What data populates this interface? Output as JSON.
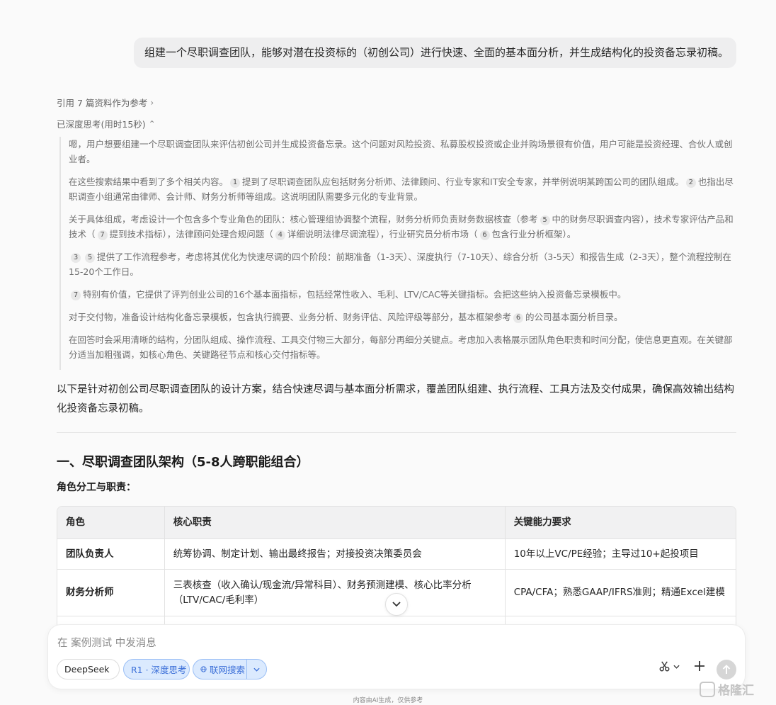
{
  "user_message": "组建一个尽职调查团队，能够对潜在投资标的（初创公司）进行快速、全面的基本面分析，并生成结构化的投资备忘录初稿。",
  "references": {
    "label": "引用 7 篇资料作为参考",
    "chevron": "›"
  },
  "thinking": {
    "label": "已深度思考(用时15秒)",
    "chevron": "⌃",
    "p1": "嗯，用户想要组建一个尽职调查团队来评估初创公司并生成投资备忘录。这个问题对风险投资、私募股权投资或企业并购场景很有价值，用户可能是投资经理、合伙人或创业者。",
    "p2a": "在这些搜索结果中看到了多个相关内容。",
    "p2r1": "1",
    "p2b": "提到了尽职调查团队应包括财务分析师、法律顾问、行业专家和IT安全专家，并举例说明某跨国公司的团队组成。",
    "p2r2": "2",
    "p2c": "也指出尽职调查小组通常由律师、会计师、财务分析师等组成。这说明团队需要多元化的专业背景。",
    "p3a": "关于具体组成，考虑设计一个包含多个专业角色的团队：核心管理组协调整个流程，财务分析师负责财务数据核查（参考",
    "p3r1": "5",
    "p3b": "中的财务尽职调查内容），技术专家评估产品和技术（",
    "p3r2": "7",
    "p3c": "提到技术指标），法律顾问处理合规问题（",
    "p3r3": "4",
    "p3d": "详细说明法律尽调流程），行业研究员分析市场（",
    "p3r4": "6",
    "p3e": "包含行业分析框架）。",
    "p4r1": "3",
    "p4r2": "5",
    "p4a": "提供了工作流程参考，考虑将其优化为快速尽调的四个阶段：前期准备（1-3天）、深度执行（7-10天）、综合分析（3-5天）和报告生成（2-3天），整个流程控制在15-20个工作日。",
    "p5r1": "7",
    "p5a": "特别有价值，它提供了评判创业公司的16个基本面指标，包括经常性收入、毛利、LTV/CAC等关键指标。会把这些纳入投资备忘录模板中。",
    "p6a": "对于交付物，准备设计结构化备忘录模板，包含执行摘要、业务分析、财务评估、风险评级等部分，基本框架参考",
    "p6r1": "6",
    "p6b": "的公司基本面分析目录。",
    "p7": "在回答时会采用清晰的结构，分团队组成、操作流程、工具交付物三大部分，每部分再细分关键点。考虑加入表格展示团队角色职责和时间分配，使信息更直观。在关键部分适当加粗强调，如核心角色、关键路径节点和核心交付指标等。"
  },
  "answer": {
    "intro": "以下是针对初创公司尽职调查团队的设计方案，结合快速尽调与基本面分析需求，覆盖团队组建、执行流程、工具方法及交付成果，确保高效输出结构化投资备忘录初稿。",
    "section_title": "一、尽职调查团队架构（5-8人跨职能组合）",
    "sub_title": "角色分工与职责：",
    "table": {
      "headers": [
        "角色",
        "核心职责",
        "关键能力要求"
      ],
      "rows": [
        [
          "团队负责人",
          "统筹协调、制定计划、输出最终报告；对接投资决策委员会",
          "10年以上VC/PE经验；主导过10+起投项目"
        ],
        [
          "财务分析师",
          "三表核查（收入确认/现金流/异常科目）、财务预测建模、核心比率分析（LTV/CAC/毛利率）",
          "CPA/CFA；熟悉GAAP/IFRS准则；精通Excel建模"
        ]
      ]
    }
  },
  "composer": {
    "placeholder": "在 案例测试 中发消息",
    "model_label": "DeepSeek",
    "deep_think_label": "R1 · 深度思考",
    "search_label": "联网搜索"
  },
  "disclaimer": "内容由AI生成，仅供参考",
  "watermark": "格隆汇"
}
